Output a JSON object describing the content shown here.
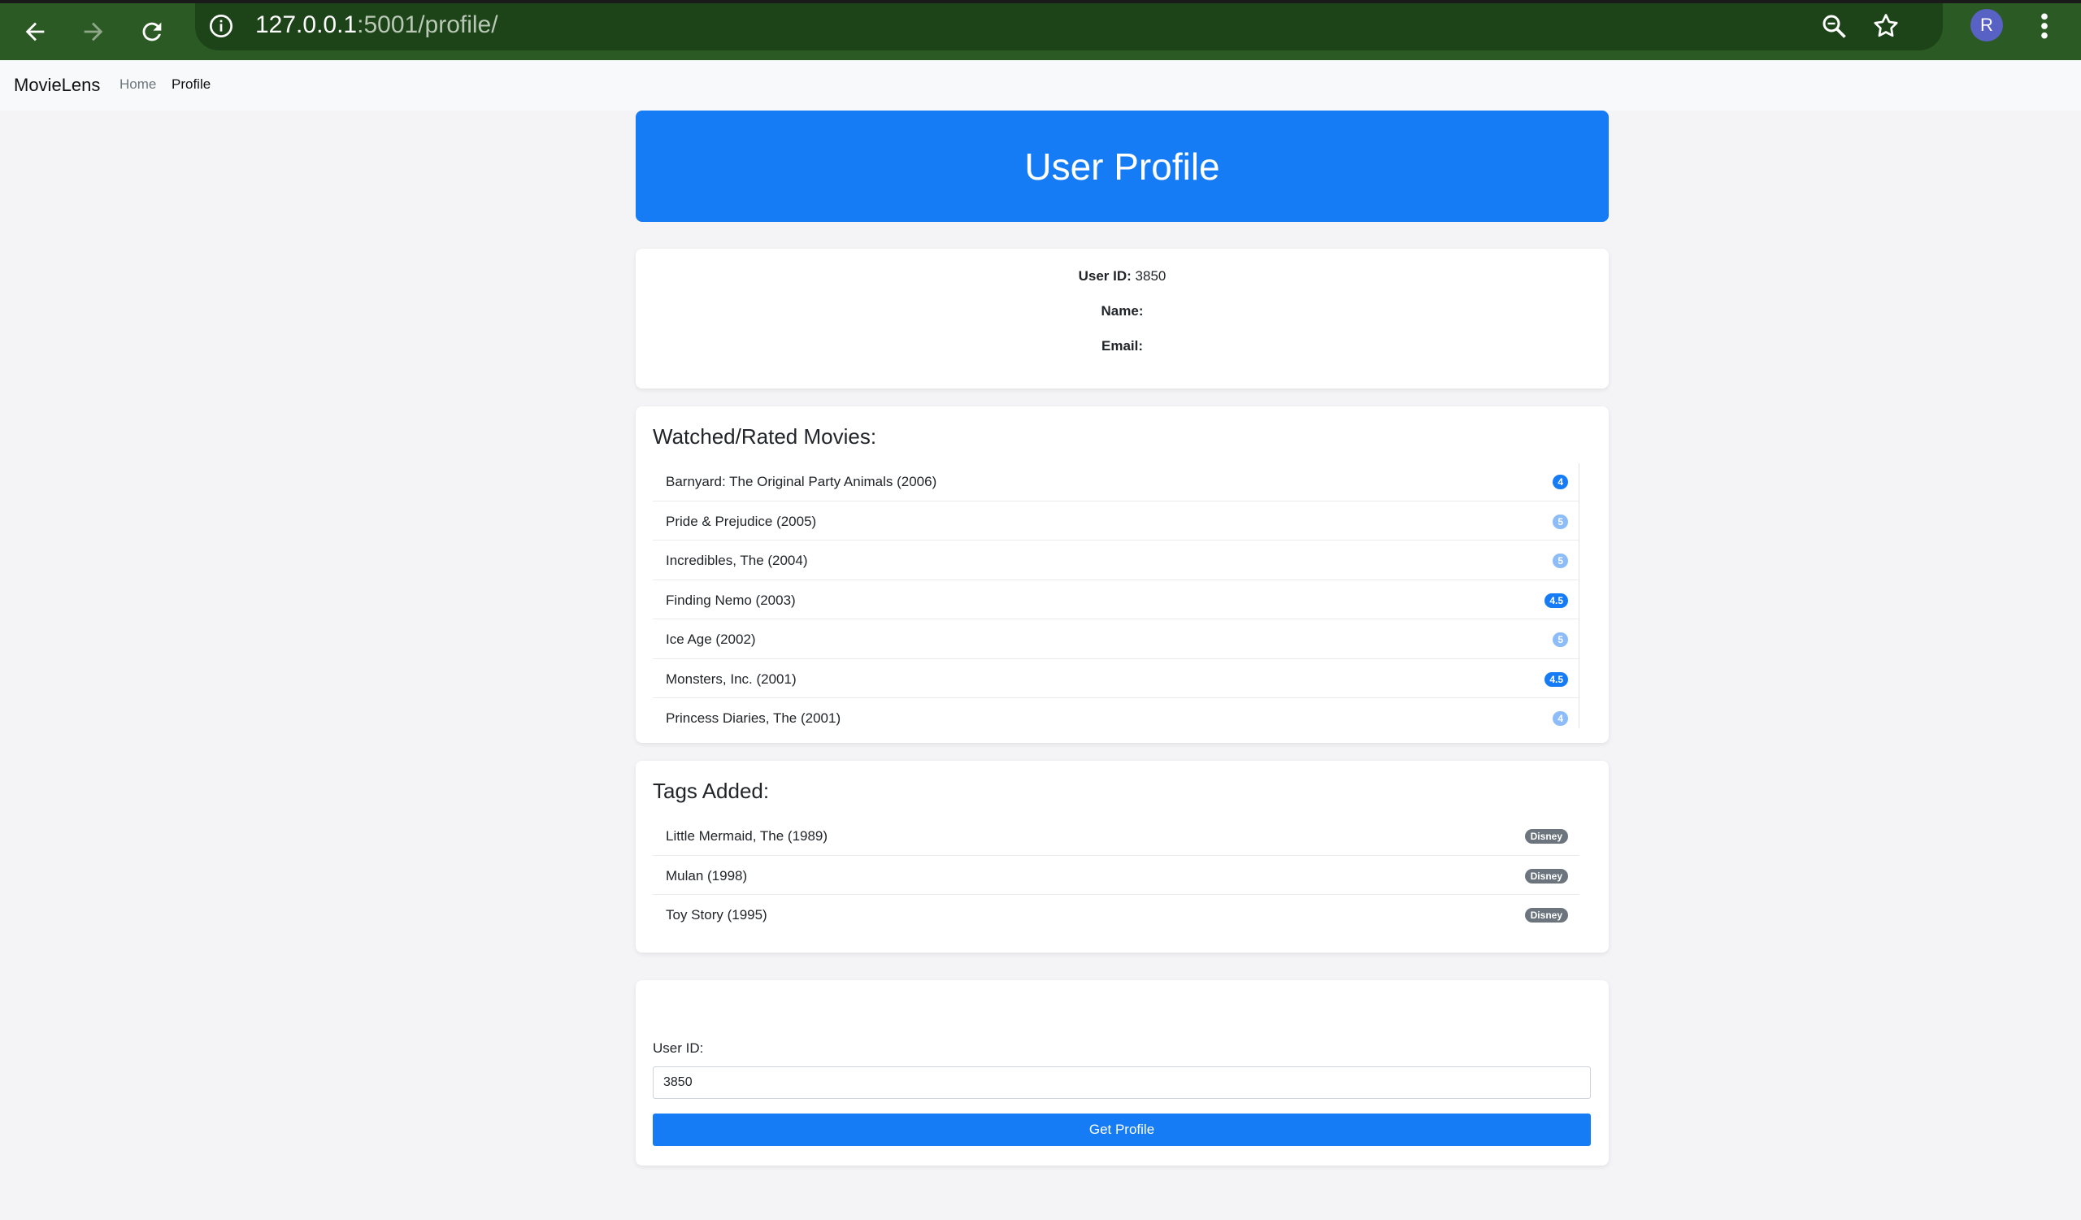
{
  "browser": {
    "url_host": "127.0.0.1",
    "url_path": ":5001/profile/",
    "avatar_letter": "R"
  },
  "navbar": {
    "brand": "MovieLens",
    "links": [
      "Home",
      "Profile"
    ]
  },
  "hero": {
    "title": "User Profile"
  },
  "user_info": {
    "user_id_label": "User ID:",
    "user_id_value": "3850",
    "name_label": "Name:",
    "name_value": "",
    "email_label": "Email:",
    "email_value": ""
  },
  "movies": {
    "heading": "Watched/Rated Movies:",
    "items": [
      {
        "title": "Barnyard: The Original Party Animals (2006)",
        "rating": "4"
      },
      {
        "title": "Pride & Prejudice (2005)",
        "rating": "5"
      },
      {
        "title": "Incredibles, The (2004)",
        "rating": "5"
      },
      {
        "title": "Finding Nemo (2003)",
        "rating": "4.5"
      },
      {
        "title": "Ice Age (2002)",
        "rating": "5"
      },
      {
        "title": "Monsters, Inc. (2001)",
        "rating": "4.5"
      },
      {
        "title": "Princess Diaries, The (2001)",
        "rating": "4"
      }
    ]
  },
  "tags": {
    "heading": "Tags Added:",
    "items": [
      {
        "title": "Little Mermaid, The (1989)",
        "tag": "Disney"
      },
      {
        "title": "Mulan (1998)",
        "tag": "Disney"
      },
      {
        "title": "Toy Story (1995)",
        "tag": "Disney"
      }
    ]
  },
  "form": {
    "label": "User ID:",
    "input_value": "3850",
    "button_label": "Get Profile"
  },
  "colors": {
    "accent": "#167cf6",
    "tag_badge": "#6c757d",
    "chrome": "#2b5a24"
  }
}
